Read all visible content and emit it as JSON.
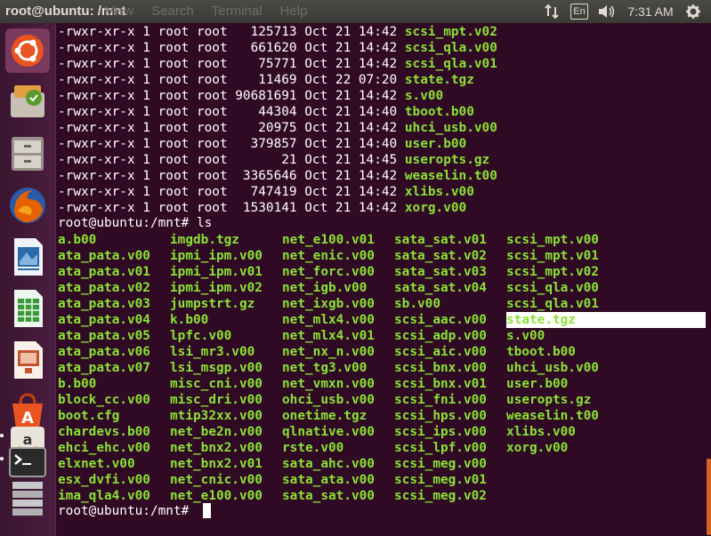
{
  "topbar": {
    "title": "root@ubuntu: /mnt",
    "menus": [
      "View",
      "Search",
      "Terminal",
      "Help"
    ],
    "keyboard": "En",
    "time": "7:31 AM"
  },
  "launcher": {
    "items": [
      {
        "name": "ubuntu-dash-icon",
        "color": "#e95420"
      },
      {
        "name": "software-updater-icon",
        "color": "#d97c2b"
      },
      {
        "name": "files-icon",
        "color": "#b8b0a6"
      },
      {
        "name": "firefox-icon",
        "color": "#e66000"
      },
      {
        "name": "libreoffice-writer-icon",
        "color": "#2a6aa8"
      },
      {
        "name": "libreoffice-calc-icon",
        "color": "#3a9a3a"
      },
      {
        "name": "libreoffice-impress-icon",
        "color": "#c0542c"
      },
      {
        "name": "ubuntu-software-center-icon",
        "color": "#e95420"
      },
      {
        "name": "amazon-icon",
        "color": "#d9a400"
      },
      {
        "name": "terminal-icon",
        "color": "#3c3c3c"
      },
      {
        "name": "workspace-switcher-icon",
        "color": "#8c8c8c"
      }
    ]
  },
  "terminal": {
    "listing": [
      {
        "perm": "-rwxr-xr-x",
        "links": "1",
        "owner": "root",
        "group": "root",
        "size": "125713",
        "date": "Oct 21 14:42",
        "name": "scsi_mpt.v02"
      },
      {
        "perm": "-rwxr-xr-x",
        "links": "1",
        "owner": "root",
        "group": "root",
        "size": "661620",
        "date": "Oct 21 14:42",
        "name": "scsi_qla.v00"
      },
      {
        "perm": "-rwxr-xr-x",
        "links": "1",
        "owner": "root",
        "group": "root",
        "size": "75771",
        "date": "Oct 21 14:42",
        "name": "scsi_qla.v01"
      },
      {
        "perm": "-rwxr-xr-x",
        "links": "1",
        "owner": "root",
        "group": "root",
        "size": "11469",
        "date": "Oct 22 07:20",
        "name": "state.tgz"
      },
      {
        "perm": "-rwxr-xr-x",
        "links": "1",
        "owner": "root",
        "group": "root",
        "size": "90681691",
        "date": "Oct 21 14:42",
        "name": "s.v00"
      },
      {
        "perm": "-rwxr-xr-x",
        "links": "1",
        "owner": "root",
        "group": "root",
        "size": "44304",
        "date": "Oct 21 14:40",
        "name": "tboot.b00"
      },
      {
        "perm": "-rwxr-xr-x",
        "links": "1",
        "owner": "root",
        "group": "root",
        "size": "20975",
        "date": "Oct 21 14:42",
        "name": "uhci_usb.v00"
      },
      {
        "perm": "-rwxr-xr-x",
        "links": "1",
        "owner": "root",
        "group": "root",
        "size": "379857",
        "date": "Oct 21 14:40",
        "name": "user.b00"
      },
      {
        "perm": "-rwxr-xr-x",
        "links": "1",
        "owner": "root",
        "group": "root",
        "size": "21",
        "date": "Oct 21 14:45",
        "name": "useropts.gz"
      },
      {
        "perm": "-rwxr-xr-x",
        "links": "1",
        "owner": "root",
        "group": "root",
        "size": "3365646",
        "date": "Oct 21 14:42",
        "name": "weaselin.t00"
      },
      {
        "perm": "-rwxr-xr-x",
        "links": "1",
        "owner": "root",
        "group": "root",
        "size": "747419",
        "date": "Oct 21 14:42",
        "name": "xlibs.v00"
      },
      {
        "perm": "-rwxr-xr-x",
        "links": "1",
        "owner": "root",
        "group": "root",
        "size": "1530141",
        "date": "Oct 21 14:42",
        "name": "xorg.v00"
      }
    ],
    "prompt1": "root@ubuntu:/mnt# ls",
    "ls_columns": [
      [
        "a.b00",
        "ata_pata.v00",
        "ata_pata.v01",
        "ata_pata.v02",
        "ata_pata.v03",
        "ata_pata.v04",
        "ata_pata.v05",
        "ata_pata.v06",
        "ata_pata.v07",
        "b.b00",
        "block_cc.v00",
        "boot.cfg",
        "chardevs.b00",
        "ehci_ehc.v00",
        "elxnet.v00",
        "esx_dvfi.v00",
        "ima_qla4.v00"
      ],
      [
        "imgdb.tgz",
        "ipmi_ipm.v00",
        "ipmi_ipm.v01",
        "ipmi_ipm.v02",
        "jumpstrt.gz",
        "k.b00",
        "lpfc.v00",
        "lsi_mr3.v00",
        "lsi_msgp.v00",
        "misc_cni.v00",
        "misc_dri.v00",
        "mtip32xx.v00",
        "net_be2n.v00",
        "net_bnx2.v00",
        "net_bnx2.v01",
        "net_cnic.v00",
        "net_e100.v00"
      ],
      [
        "net_e100.v01",
        "net_enic.v00",
        "net_forc.v00",
        "net_igb.v00",
        "net_ixgb.v00",
        "net_mlx4.v00",
        "net_mlx4.v01",
        "net_nx_n.v00",
        "net_tg3.v00",
        "net_vmxn.v00",
        "ohci_usb.v00",
        "onetime.tgz",
        "qlnative.v00",
        "rste.v00",
        "sata_ahc.v00",
        "sata_ata.v00",
        "sata_sat.v00"
      ],
      [
        "sata_sat.v01",
        "sata_sat.v02",
        "sata_sat.v03",
        "sata_sat.v04",
        "sb.v00",
        "scsi_aac.v00",
        "scsi_adp.v00",
        "scsi_aic.v00",
        "scsi_bnx.v00",
        "scsi_bnx.v01",
        "scsi_fni.v00",
        "scsi_hps.v00",
        "scsi_ips.v00",
        "scsi_lpf.v00",
        "scsi_meg.v00",
        "scsi_meg.v01",
        "scsi_meg.v02"
      ],
      [
        "scsi_mpt.v00",
        "scsi_mpt.v01",
        "scsi_mpt.v02",
        "scsi_qla.v00",
        "scsi_qla.v01",
        "state.tgz",
        "s.v00",
        "tboot.b00",
        "uhci_usb.v00",
        "user.b00",
        "useropts.gz",
        "weaselin.t00",
        "xlibs.v00",
        "xorg.v00"
      ]
    ],
    "highlighted_file": "state.tgz",
    "prompt2": "root@ubuntu:/mnt#"
  }
}
